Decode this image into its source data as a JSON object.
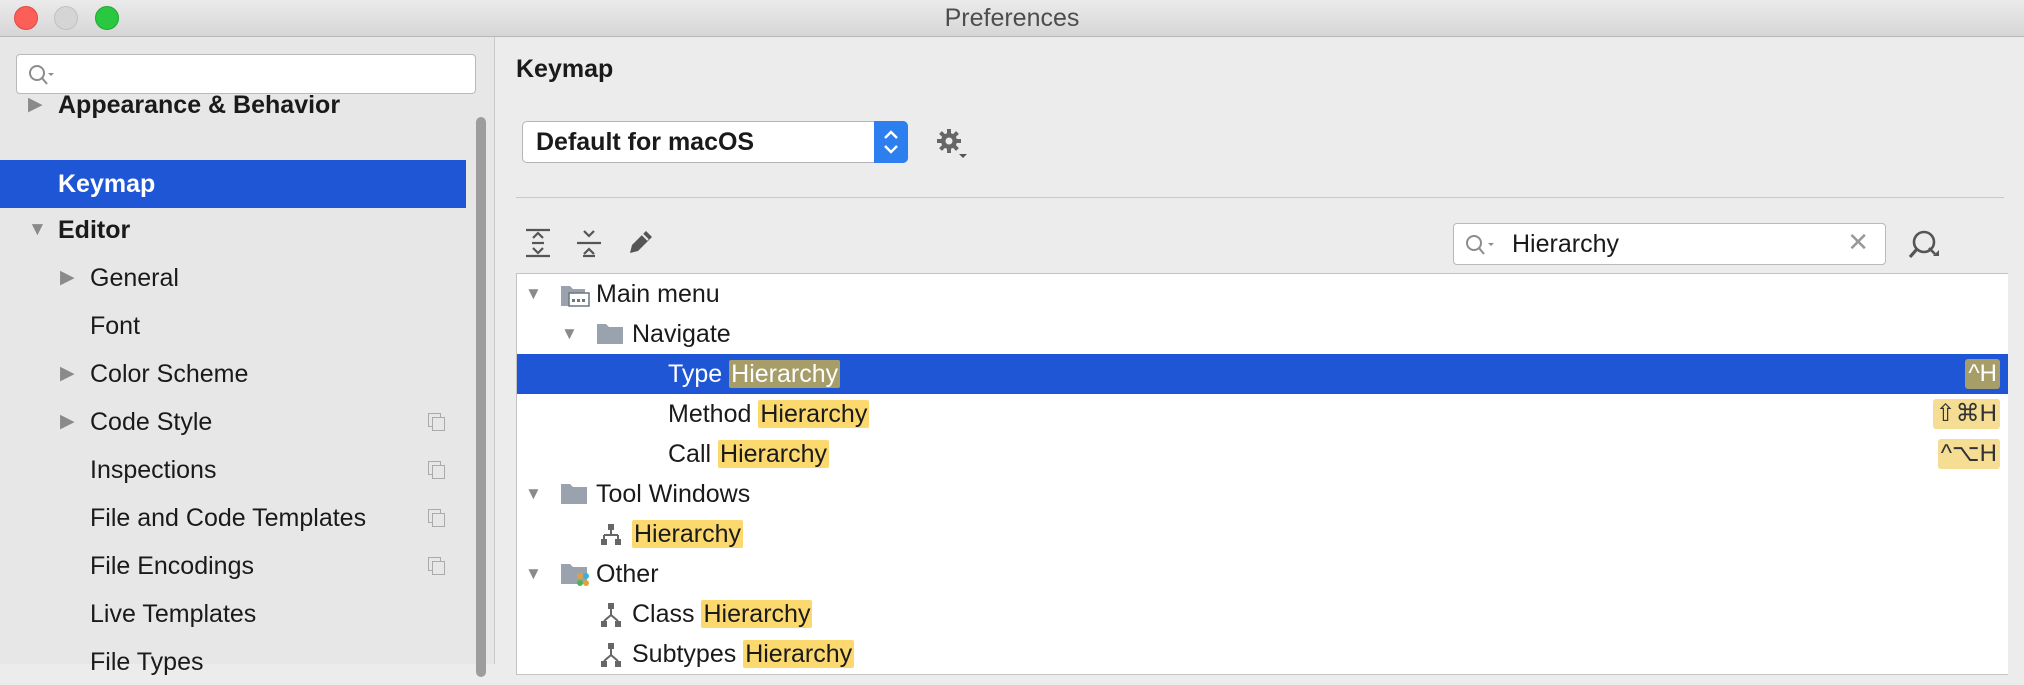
{
  "window": {
    "title": "Preferences"
  },
  "sidebar": {
    "search_placeholder": "",
    "items": [
      {
        "label": "Appearance & Behavior",
        "arrow": "▶"
      },
      {
        "label": "Keymap"
      },
      {
        "label": "Editor",
        "arrow": "▼"
      },
      {
        "label": "General",
        "arrow": "▶"
      },
      {
        "label": "Font"
      },
      {
        "label": "Color Scheme",
        "arrow": "▶"
      },
      {
        "label": "Code Style",
        "arrow": "▶"
      },
      {
        "label": "Inspections"
      },
      {
        "label": "File and Code Templates"
      },
      {
        "label": "File Encodings"
      },
      {
        "label": "Live Templates"
      },
      {
        "label": "File Types"
      }
    ]
  },
  "main": {
    "title": "Keymap",
    "keymap_value": "Default for macOS",
    "filter_value": "Hierarchy",
    "tree": {
      "main_menu": "Main menu",
      "navigate": "Navigate",
      "type_prefix": "Type ",
      "method_prefix": "Method ",
      "call_prefix": "Call ",
      "tool_windows": "Tool Windows",
      "other": "Other",
      "class_prefix": "Class ",
      "subtypes_prefix": "Subtypes ",
      "highlight": "Hierarchy",
      "type_shortcut": "^H",
      "method_shortcut": "⇧⌘H",
      "call_shortcut": "^⌥H"
    }
  },
  "colors": {
    "selection": "#1e56d6",
    "highlight": "#fbd96f",
    "accent": "#2d7ff0"
  }
}
